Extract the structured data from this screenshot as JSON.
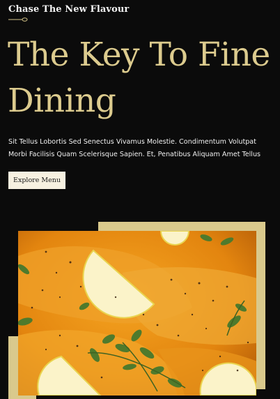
{
  "header": {
    "tagline": "Chase The New Flavour",
    "ornament_icon": "spoon-divider-icon"
  },
  "hero": {
    "title_line1": "The Key To Fine",
    "title_line2": "Dining",
    "description": "Sit Tellus Lobortis Sed Senectus Vivamus Molestie. Condimentum Volutpat Morbi Facilisis Quam Scelerisque Sapien. Et, Penatibus Aliquam Amet Tellus",
    "cta_label": "Explore Menu"
  },
  "colors": {
    "background": "#0b0b0b",
    "accent_gold": "#dccb8e",
    "frame_gold": "#d9c98c",
    "button_bg": "#f7f1e1"
  },
  "image": {
    "subject": "salmon-with-lemon-and-herbs"
  }
}
